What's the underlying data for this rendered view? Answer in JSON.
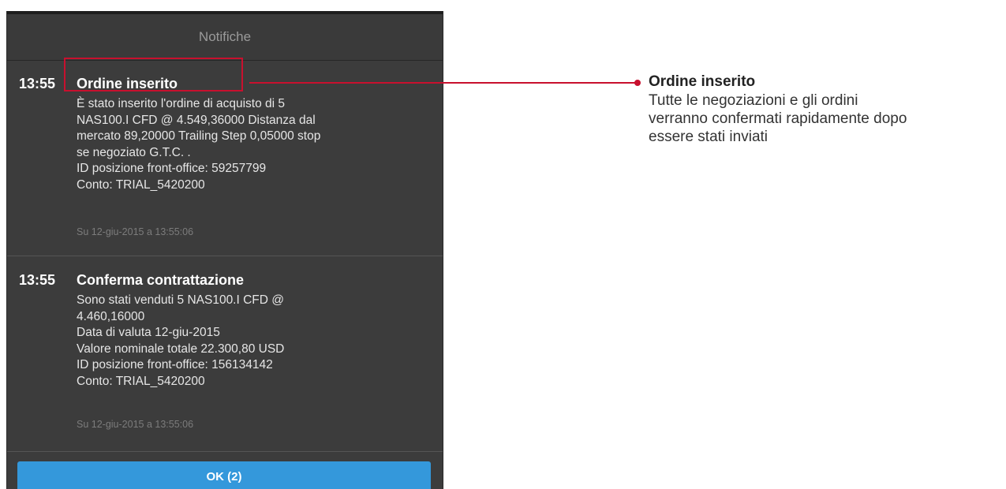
{
  "notifications_panel": {
    "title": "Notifiche",
    "items": [
      {
        "time": "13:55",
        "title": "Ordine inserito",
        "body_lines": [
          "È stato inserito l'ordine di acquisto di 5",
          "NAS100.I CFD @ 4.549,36000 Distanza dal",
          "mercato 89,20000 Trailing Step 0,05000 stop",
          "se negoziato G.T.C. .",
          "ID posizione front-office: 59257799",
          "Conto: TRIAL_5420200"
        ],
        "date": "Su 12-giu-2015 a 13:55:06"
      },
      {
        "time": "13:55",
        "title": "Conferma contrattazione",
        "body_lines": [
          "Sono stati venduti 5 NAS100.I CFD @",
          "4.460,16000",
          "Data di valuta 12-giu-2015",
          "Valore nominale totale 22.300,80 USD",
          "ID posizione front-office: 156134142",
          "Conto: TRIAL_5420200"
        ],
        "date": "Su 12-giu-2015 a 13:55:06"
      }
    ],
    "ok_button_label": "OK (2)"
  },
  "callout": {
    "title": "Ordine inserito",
    "text_lines": [
      "Tutte le negoziazioni e gli ordini",
      "verranno confermati rapidamente dopo",
      "essere stati inviati"
    ]
  },
  "colors": {
    "accent_red": "#c8102e",
    "button_blue": "#3498db",
    "panel_bg": "#3c3c3c"
  }
}
